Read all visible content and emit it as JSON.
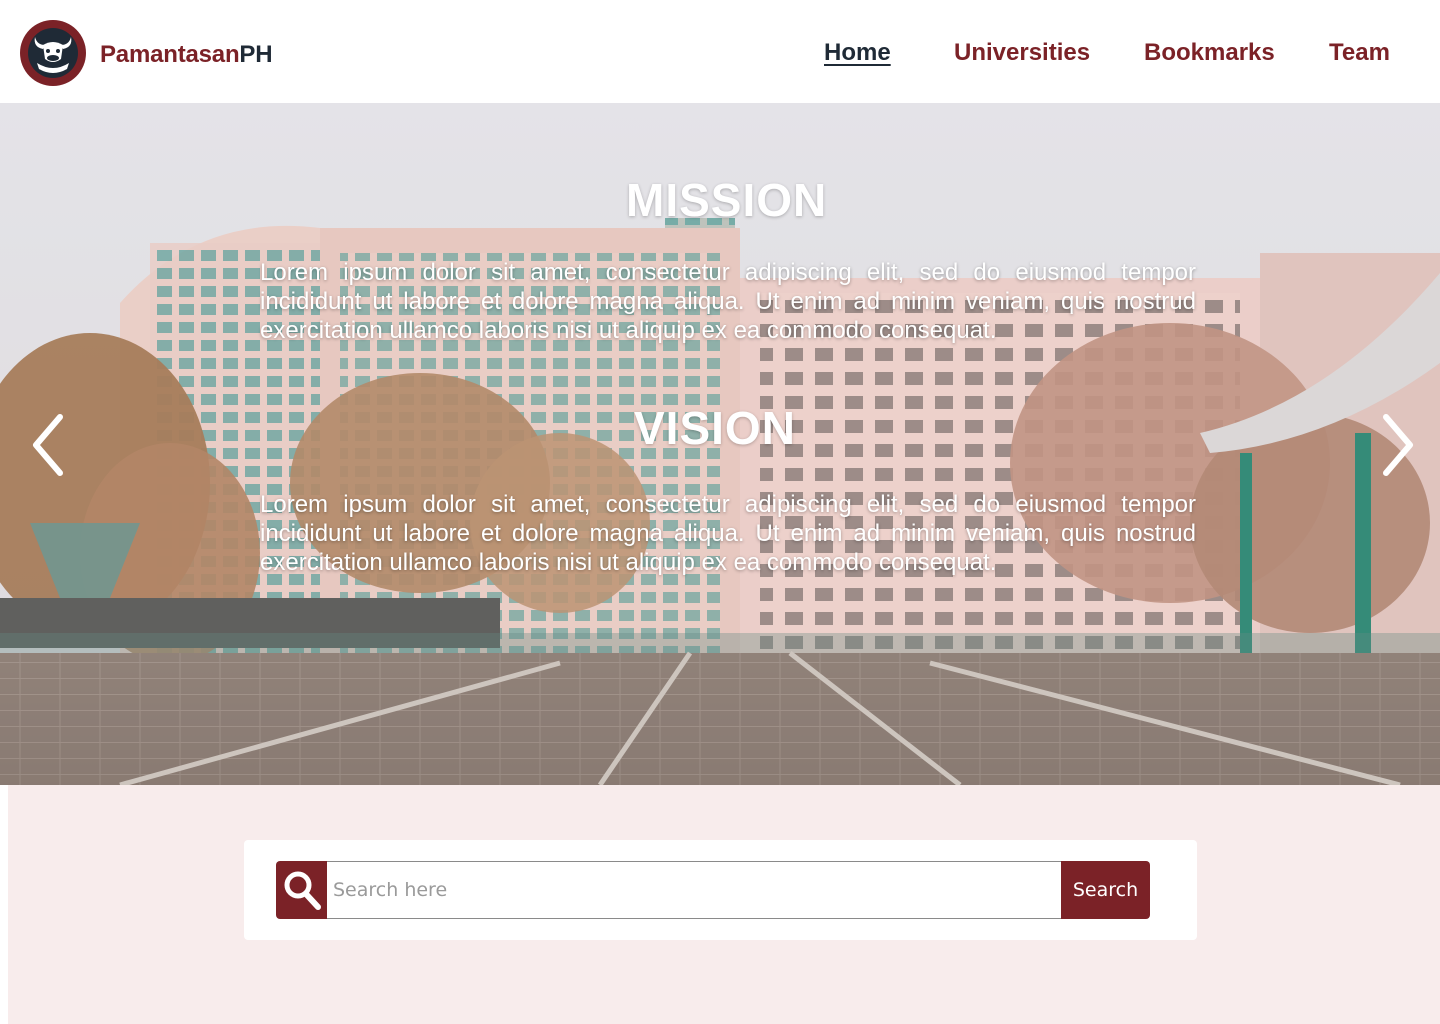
{
  "brand": {
    "part1": "Pamantasan",
    "part2": "PH"
  },
  "nav": {
    "items": [
      {
        "label": "Home",
        "active": true
      },
      {
        "label": "Universities",
        "active": false
      },
      {
        "label": "Bookmarks",
        "active": false
      },
      {
        "label": "Team",
        "active": false
      }
    ]
  },
  "hero": {
    "mission_title": "MISSION",
    "mission_text": "Lorem ipsum dolor sit amet, consectetur adipiscing elit, sed do eiusmod tempor incididunt ut labore et dolore magna aliqua. Ut enim ad minim veniam, quis nostrud exercitation ullamco laboris nisi ut aliquip ex ea commodo consequat.",
    "vision_title": "VISION",
    "vision_text": "Lorem ipsum dolor sit amet, consectetur adipiscing elit, sed do eiusmod tempor incididunt ut labore et dolore magna aliqua. Ut enim ad minim veniam, quis nostrud exercitation ullamco laboris nisi ut aliquip ex ea commodo consequat.",
    "prev_icon": "chevron-left-icon",
    "next_icon": "chevron-right-icon"
  },
  "search": {
    "placeholder": "Search here",
    "value": "",
    "button_label": "Search",
    "icon": "search-icon"
  },
  "colors": {
    "brand": "#7b2227",
    "dark": "#1f2a36",
    "section_bg": "#f8ecec"
  }
}
